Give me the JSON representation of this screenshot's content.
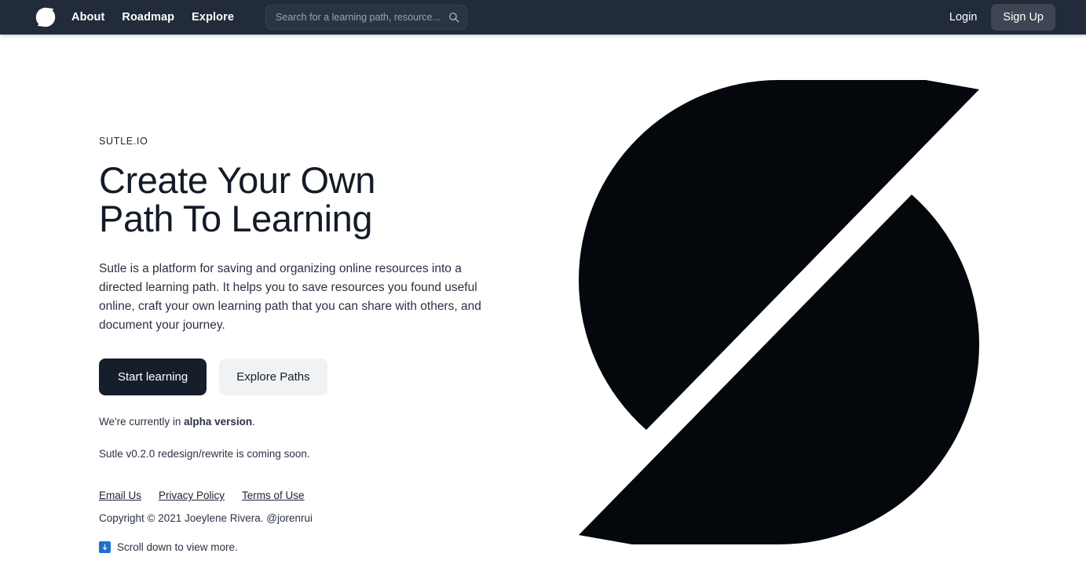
{
  "navbar": {
    "logo_icon": "sutle-logo-icon",
    "links": [
      {
        "label": "About"
      },
      {
        "label": "Roadmap"
      },
      {
        "label": "Explore"
      }
    ],
    "search": {
      "placeholder": "Search for a learning path, resource...",
      "value": "",
      "icon": "search-icon"
    },
    "login_label": "Login",
    "signup_label": "Sign Up",
    "background_color": "#222b3a",
    "signup_background_color": "#3e4654"
  },
  "hero": {
    "eyebrow": "SUTLE.IO",
    "title_line1": "Create Your Own",
    "title_line2": "Path To Learning",
    "description": "Sutle is a platform for saving and organizing online resources into a directed learning path. It helps you to save resources you found useful online, craft your own learning path that you can share with others, and document your journey.",
    "primary_cta": "Start learning",
    "secondary_cta": "Explore Paths",
    "alpha_prefix": "We're currently in ",
    "alpha_strong": "alpha version",
    "alpha_suffix": ".",
    "version_note": "Sutle v0.2.0 redesign/rewrite is coming soon.",
    "footer_links": [
      {
        "label": "Email Us"
      },
      {
        "label": "Privacy Policy"
      },
      {
        "label": "Terms of Use"
      }
    ],
    "copyright": "Copyright © 2021 Joeylene Rivera. @jorenrui",
    "scroll_icon": "arrow-down-icon",
    "scroll_text": "Scroll down to view more.",
    "graphic_icon": "sutle-mark-graphic",
    "graphic_color": "#04070c",
    "scroll_badge_color": "#1f6fd0",
    "primary_cta_color": "#161d2b",
    "secondary_cta_color": "#f1f2f4"
  }
}
